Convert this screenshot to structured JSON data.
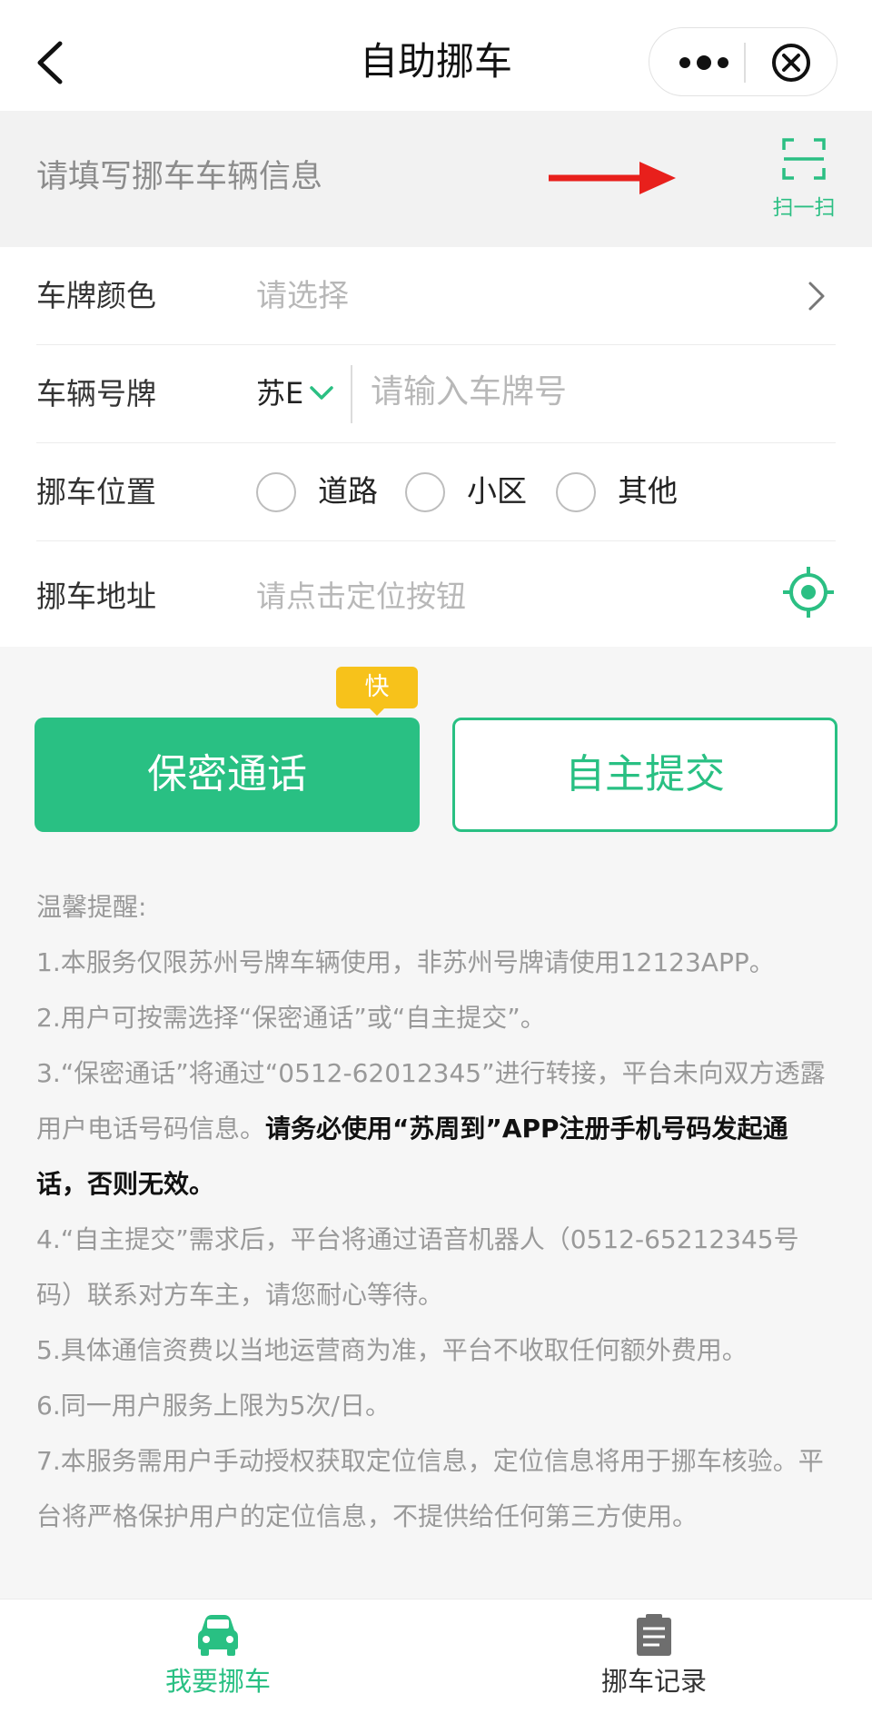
{
  "nav": {
    "title": "自助挪车"
  },
  "scan": {
    "hint": "请填写挪车车辆信息",
    "label": "扫一扫"
  },
  "form": {
    "color": {
      "label": "车牌颜色",
      "placeholder": "请选择"
    },
    "plate": {
      "label": "车辆号牌",
      "prefix": "苏E",
      "placeholder": "请输入车牌号"
    },
    "location": {
      "label": "挪车位置",
      "options": [
        "道路",
        "小区",
        "其他"
      ]
    },
    "address": {
      "label": "挪车地址",
      "placeholder": "请点击定位按钮"
    }
  },
  "actions": {
    "badge": "快",
    "call_label": "保密通话",
    "submit_label": "自主提交"
  },
  "notice": {
    "title": "温馨提醒:",
    "items": [
      "1.本服务仅限苏州号牌车辆使用，非苏州号牌请使用12123APP。",
      "2.用户可按需选择“保密通话”或“自主提交”。",
      "3.“保密通话”将通过“0512-62012345”进行转接，平台未向双方透露用户电话号码信息。",
      "请务必使用“苏周到”APP注册手机号码发起通话，否则无效。",
      "4.“自主提交”需求后，平台将通过语音机器人（0512-65212345号码）联系对方车主，请您耐心等待。",
      "5.具体通信资费以当地运营商为准，平台不收取任何额外费用。",
      "6.同一用户服务上限为5次/日。",
      "7.本服务需用户手动授权获取定位信息，定位信息将用于挪车核验。平台将严格保护用户的定位信息，不提供给任何第三方使用。"
    ]
  },
  "tabs": [
    {
      "label": "我要挪车",
      "icon": "car-icon"
    },
    {
      "label": "挪车记录",
      "icon": "clipboard-icon"
    }
  ],
  "colors": {
    "accent": "#29c083",
    "badge": "#f7c21b",
    "arrow": "#e8201c"
  }
}
